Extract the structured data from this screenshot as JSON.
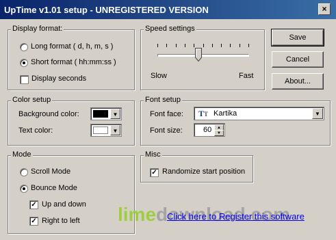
{
  "window": {
    "title": "UpTime v1.01 setup - UNREGISTERED VERSION",
    "close_glyph": "×"
  },
  "display_format": {
    "legend": "Display format:",
    "options": [
      {
        "label": "Long format ( d, h, m, s )",
        "selected": false
      },
      {
        "label": "Short format ( hh:mm:ss )",
        "selected": true
      }
    ],
    "display_seconds": {
      "label": "Display seconds",
      "checked": false
    }
  },
  "speed": {
    "legend": "Speed settings",
    "slow_label": "Slow",
    "fast_label": "Fast",
    "value_fraction": 0.3
  },
  "color_setup": {
    "legend": "Color setup",
    "background": {
      "label": "Background color:",
      "color": "#000000"
    },
    "text": {
      "label": "Text color:",
      "color": "#ffffff"
    }
  },
  "font_setup": {
    "legend": "Font setup",
    "face_label": "Font face:",
    "face_value": "Kartika",
    "face_icon": "truetype-icon",
    "size_label": "Font size:",
    "size_value": "60"
  },
  "mode": {
    "legend": "Mode",
    "options": [
      {
        "label": "Scroll Mode",
        "selected": false
      },
      {
        "label": "Bounce Mode",
        "selected": true
      }
    ],
    "up_and_down": {
      "label": "Up and down",
      "checked": true
    },
    "right_to_left": {
      "label": "Right to left",
      "checked": true
    }
  },
  "misc": {
    "legend": "Misc",
    "randomize": {
      "label": "Randomize start position",
      "checked": true
    }
  },
  "buttons": {
    "save": "Save",
    "cancel": "Cancel",
    "about": "About..."
  },
  "register_link": "Click here to Register this software",
  "watermark": {
    "part1": "lime",
    "part2": "download",
    "part3": ".com",
    "color1": "#9acd32",
    "color2": "#a0a0a0"
  }
}
